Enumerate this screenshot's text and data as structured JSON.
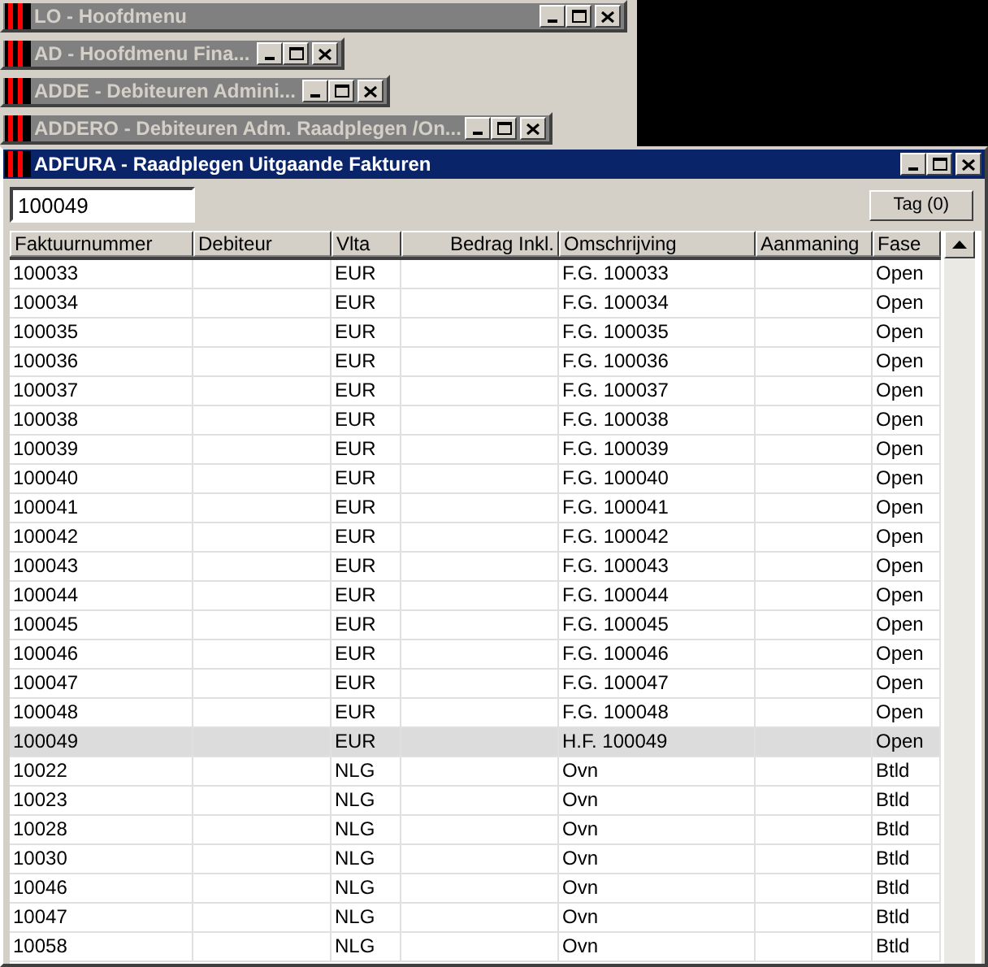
{
  "minimized_windows": [
    {
      "title": "LO - Hoofdmenu",
      "active": false
    },
    {
      "title": "AD - Hoofdmenu Fina...",
      "active": false
    },
    {
      "title": "ADDE - Debiteuren Admini...",
      "active": false
    },
    {
      "title": "ADDERO - Debiteuren Adm. Raadplegen /On...",
      "active": false
    }
  ],
  "window": {
    "title": "ADFURA - Raadplegen Uitgaande Fakturen",
    "active": true
  },
  "search": {
    "value": "100049"
  },
  "tag_button": "Tag (0)",
  "table": {
    "columns": [
      "Faktuurnummer",
      "Debiteur",
      "Vlta",
      "Bedrag Inkl.",
      "Omschrijving",
      "Aanmaning",
      "Fase"
    ],
    "rows": [
      {
        "faktuurnummer": "100033",
        "vlta": "EUR",
        "omschrijving": "F.G. 100033",
        "fase": "Open",
        "selected": false
      },
      {
        "faktuurnummer": "100034",
        "vlta": "EUR",
        "omschrijving": "F.G. 100034",
        "fase": "Open",
        "selected": false
      },
      {
        "faktuurnummer": "100035",
        "vlta": "EUR",
        "omschrijving": "F.G. 100035",
        "fase": "Open",
        "selected": false
      },
      {
        "faktuurnummer": "100036",
        "vlta": "EUR",
        "omschrijving": "F.G. 100036",
        "fase": "Open",
        "selected": false
      },
      {
        "faktuurnummer": "100037",
        "vlta": "EUR",
        "omschrijving": "F.G. 100037",
        "fase": "Open",
        "selected": false
      },
      {
        "faktuurnummer": "100038",
        "vlta": "EUR",
        "omschrijving": "F.G. 100038",
        "fase": "Open",
        "selected": false
      },
      {
        "faktuurnummer": "100039",
        "vlta": "EUR",
        "omschrijving": "F.G. 100039",
        "fase": "Open",
        "selected": false
      },
      {
        "faktuurnummer": "100040",
        "vlta": "EUR",
        "omschrijving": "F.G. 100040",
        "fase": "Open",
        "selected": false
      },
      {
        "faktuurnummer": "100041",
        "vlta": "EUR",
        "omschrijving": "F.G. 100041",
        "fase": "Open",
        "selected": false
      },
      {
        "faktuurnummer": "100042",
        "vlta": "EUR",
        "omschrijving": "F.G. 100042",
        "fase": "Open",
        "selected": false
      },
      {
        "faktuurnummer": "100043",
        "vlta": "EUR",
        "omschrijving": "F.G. 100043",
        "fase": "Open",
        "selected": false
      },
      {
        "faktuurnummer": "100044",
        "vlta": "EUR",
        "omschrijving": "F.G. 100044",
        "fase": "Open",
        "selected": false
      },
      {
        "faktuurnummer": "100045",
        "vlta": "EUR",
        "omschrijving": "F.G. 100045",
        "fase": "Open",
        "selected": false
      },
      {
        "faktuurnummer": "100046",
        "vlta": "EUR",
        "omschrijving": "F.G. 100046",
        "fase": "Open",
        "selected": false
      },
      {
        "faktuurnummer": "100047",
        "vlta": "EUR",
        "omschrijving": "F.G. 100047",
        "fase": "Open",
        "selected": false
      },
      {
        "faktuurnummer": "100048",
        "vlta": "EUR",
        "omschrijving": "F.G. 100048",
        "fase": "Open",
        "selected": false
      },
      {
        "faktuurnummer": "100049",
        "vlta": "EUR",
        "omschrijving": "H.F. 100049",
        "fase": "Open",
        "selected": true
      },
      {
        "faktuurnummer": "10022",
        "vlta": "NLG",
        "omschrijving": "Ovn",
        "fase": "Btld",
        "selected": false
      },
      {
        "faktuurnummer": "10023",
        "vlta": "NLG",
        "omschrijving": "Ovn",
        "fase": "Btld",
        "selected": false
      },
      {
        "faktuurnummer": "10028",
        "vlta": "NLG",
        "omschrijving": "Ovn",
        "fase": "Btld",
        "selected": false
      },
      {
        "faktuurnummer": "10030",
        "vlta": "NLG",
        "omschrijving": "Ovn",
        "fase": "Btld",
        "selected": false
      },
      {
        "faktuurnummer": "10046",
        "vlta": "NLG",
        "omschrijving": "Ovn",
        "fase": "Btld",
        "selected": false
      },
      {
        "faktuurnummer": "10047",
        "vlta": "NLG",
        "omschrijving": "Ovn",
        "fase": "Btld",
        "selected": false
      },
      {
        "faktuurnummer": "10058",
        "vlta": "NLG",
        "omschrijving": "Ovn",
        "fase": "Btld",
        "selected": false
      }
    ]
  }
}
